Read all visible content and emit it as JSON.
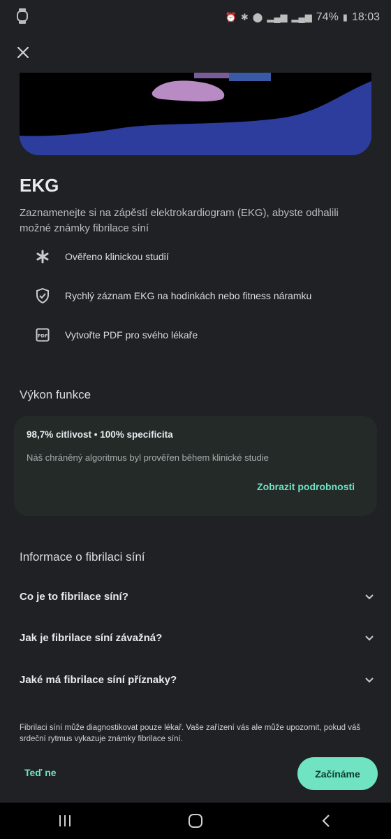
{
  "status_bar": {
    "battery": "74%",
    "time": "18:03"
  },
  "page": {
    "title": "EKG",
    "description": "Zaznamenejte si na zápěstí elektrokardiogram (EKG), abyste odhalili možné známky fibrilace síní"
  },
  "features": [
    {
      "icon": "asterisk-icon",
      "label": "Ověřeno klinickou studií"
    },
    {
      "icon": "shield-check-icon",
      "label": "Rychlý záznam EKG na hodinkách nebo fitness náramku"
    },
    {
      "icon": "pdf-icon",
      "label": "Vytvořte PDF pro svého lékaře"
    }
  ],
  "performance": {
    "section_title": "Výkon funkce",
    "headline": "98,7% citlivost • 100% specificita",
    "subtitle": "Náš chráněný algoritmus byl prověřen během klinické studie",
    "link": "Zobrazit podrobnosti"
  },
  "afib_info": {
    "section_title": "Informace o fibrilaci síní",
    "questions": [
      "Co je to fibrilace síní?",
      "Jak je fibrilace síní závažná?",
      "Jaké má fibrilace síní příznaky?"
    ]
  },
  "footer": {
    "disclaimer": "Fibrilaci síní může diagnostikovat pouze lékař. Vaše zařízení vás ale může upozornit, pokud váš srdeční rytmus vykazuje známky fibrilace síní.",
    "later_button": "Teď ne",
    "start_button": "Začínáme"
  },
  "colors": {
    "accent": "#6fe3c2",
    "background": "#202124",
    "card": "#232a28"
  }
}
